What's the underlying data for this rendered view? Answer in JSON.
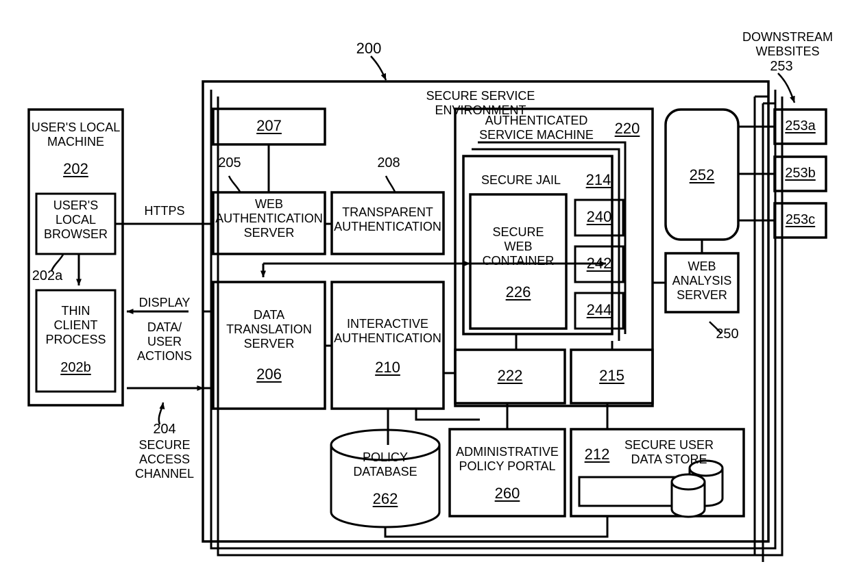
{
  "figure": {
    "title": "Secure service environment architecture block diagram",
    "environment_label": "SECURE SERVICE ENVIRONMENT",
    "environment_ref": "200"
  },
  "left": {
    "local_machine": {
      "label": "USER'S LOCAL\nMACHINE",
      "ref": "202"
    },
    "local_browser": {
      "label": "USER'S\nLOCAL\nBROWSER",
      "ref": "202a"
    },
    "thin_client": {
      "label": "THIN\nCLIENT\nPROCESS",
      "ref": "202b"
    },
    "https_label": "HTTPS",
    "display_label": "DISPLAY",
    "data_user_actions_label": "DATA/\nUSER\nACTIONS",
    "secure_access_channel": {
      "ref": "204",
      "label": "SECURE\nACCESS\nCHANNEL"
    }
  },
  "center": {
    "box_207": {
      "ref": "207"
    },
    "web_auth_server": {
      "label": "WEB\nAUTHENTICATION\nSERVER",
      "ref": "205"
    },
    "transparent_auth": {
      "label": "TRANSPARENT\nAUTHENTICATION",
      "ref": "208"
    },
    "data_translation_server": {
      "label": "DATA\nTRANSLATION\nSERVER",
      "ref": "206"
    },
    "interactive_auth": {
      "label": "INTERACTIVE\nAUTHENTICATION",
      "ref": "210"
    },
    "policy_database": {
      "label": "POLICY\nDATABASE",
      "ref": "262"
    },
    "admin_policy_portal": {
      "label": "ADMINISTRATIVE\nPOLICY PORTAL",
      "ref": "260"
    },
    "secure_user_data_store": {
      "label": "SECURE USER\nDATA STORE",
      "ref": "212"
    }
  },
  "machine": {
    "authenticated_service_machine": {
      "label": "AUTHENTICATED\nSERVICE MACHINE",
      "ref": "220"
    },
    "secure_jail": {
      "label": "SECURE JAIL",
      "ref": "214"
    },
    "secure_web_container": {
      "label": "SECURE\nWEB\nCONTAINER",
      "ref": "226"
    },
    "modules": [
      {
        "ref": "240"
      },
      {
        "ref": "242"
      },
      {
        "ref": "244"
      }
    ],
    "box_222": {
      "ref": "222"
    },
    "box_215": {
      "ref": "215"
    }
  },
  "right": {
    "proxy_252": {
      "ref": "252"
    },
    "web_analysis_server": {
      "label": "WEB\nANALYSIS\nSERVER",
      "ref": "250"
    },
    "downstream_websites": {
      "label": "DOWNSTREAM\nWEBSITES",
      "ref": "253",
      "items": [
        {
          "ref": "253a"
        },
        {
          "ref": "253b"
        },
        {
          "ref": "253c"
        }
      ]
    }
  },
  "colors": {
    "stroke": "#000000",
    "background": "#ffffff"
  }
}
